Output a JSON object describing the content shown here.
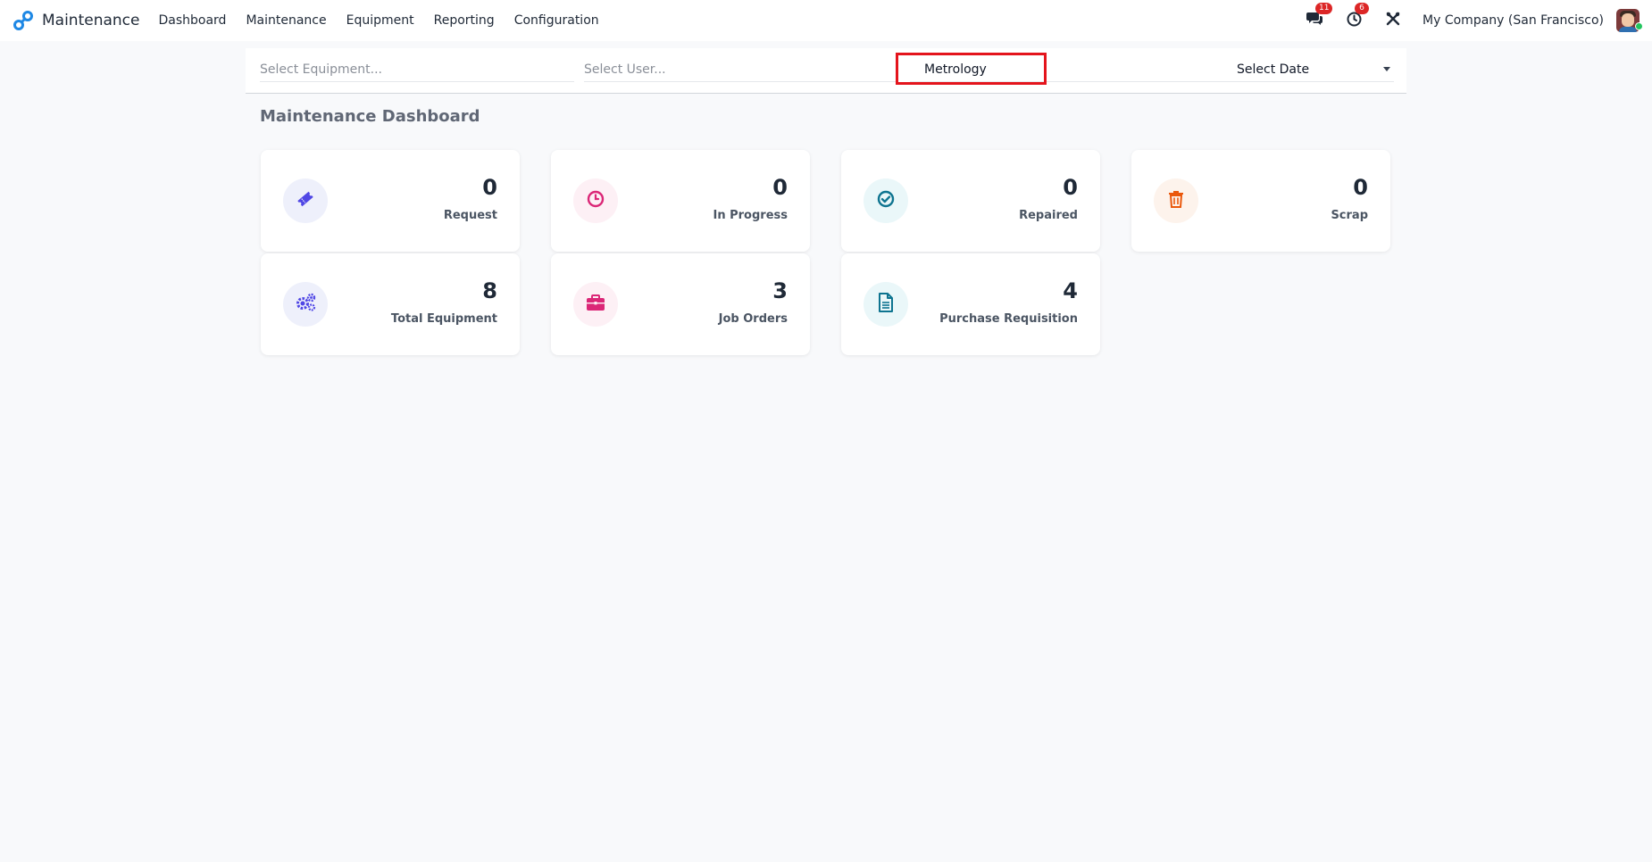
{
  "app": {
    "name": "Maintenance"
  },
  "nav": {
    "menu": [
      {
        "label": "Dashboard"
      },
      {
        "label": "Maintenance"
      },
      {
        "label": "Equipment"
      },
      {
        "label": "Reporting"
      },
      {
        "label": "Configuration"
      }
    ],
    "messages_badge": "11",
    "activities_badge": "6",
    "company": "My Company (San Francisco)"
  },
  "filters": {
    "equipment_placeholder": "Select Equipment...",
    "user_placeholder": "Select User...",
    "category_value": "Metrology",
    "date_label": "Select Date"
  },
  "dashboard": {
    "title": "Maintenance Dashboard",
    "cards": [
      {
        "value": "0",
        "label": "Request",
        "icon": "ticket-icon",
        "color": "#4f46e5",
        "bg": "#eef0fb"
      },
      {
        "value": "0",
        "label": "In Progress",
        "icon": "clock-icon",
        "color": "#db2777",
        "bg": "#fdf0f5"
      },
      {
        "value": "0",
        "label": "Repaired",
        "icon": "check-circle-icon",
        "color": "#0e7490",
        "bg": "#eaf7f9"
      },
      {
        "value": "0",
        "label": "Scrap",
        "icon": "trash-icon",
        "color": "#ea580c",
        "bg": "#fdf3ec"
      },
      {
        "value": "8",
        "label": "Total Equipment",
        "icon": "cogs-icon",
        "color": "#4f46e5",
        "bg": "#eef0fb"
      },
      {
        "value": "3",
        "label": "Job Orders",
        "icon": "briefcase-icon",
        "color": "#db2777",
        "bg": "#fdf0f5"
      },
      {
        "value": "4",
        "label": "Purchase Requisition",
        "icon": "document-icon",
        "color": "#0e7490",
        "bg": "#eaf7f9"
      }
    ]
  },
  "colors": {
    "brand_blue": "#1e88e5",
    "highlight_red": "#e4141c",
    "badge_red": "#dc2626"
  }
}
